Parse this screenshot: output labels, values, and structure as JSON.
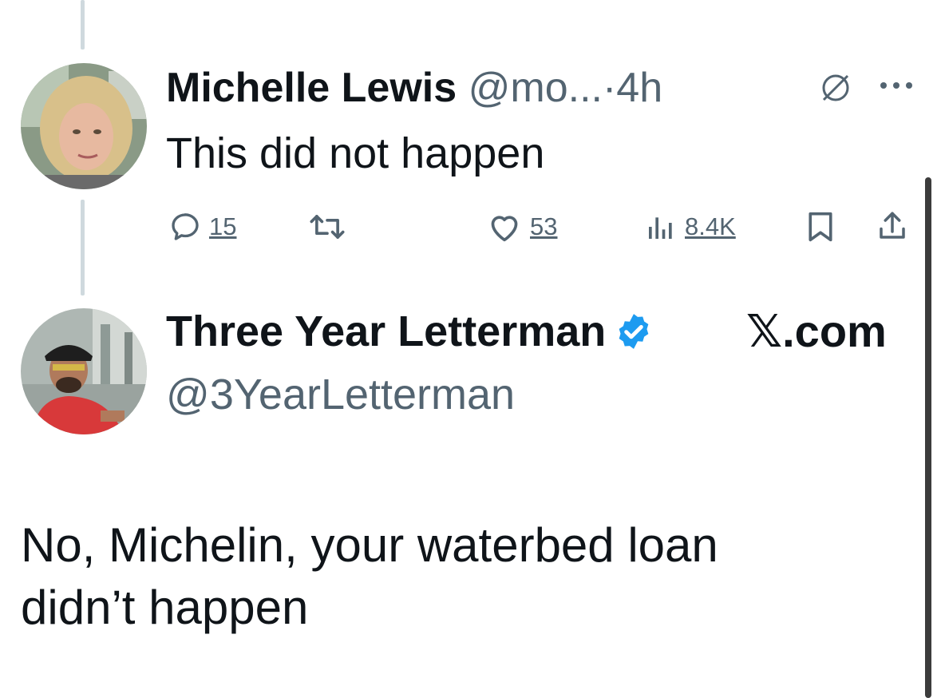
{
  "reply_tweet": {
    "author_name": "Michelle Lewis",
    "author_handle": "@mo...",
    "separator": "·",
    "time": "4h",
    "text": "This did not happen",
    "actions": {
      "replies": "15",
      "likes": "53",
      "views": "8.4K"
    }
  },
  "quoted_post": {
    "author_name": "Three Year Letterman",
    "verified": true,
    "source": "𝕏.com",
    "author_handle": "@3YearLetterman",
    "text_line1": "No, Michelin, your waterbed loan",
    "text_line2": "didn’t happen"
  },
  "colors": {
    "text": "#0f1419",
    "muted": "#536471",
    "verified": "#1d9bf0",
    "thread_line": "#cfd9de"
  },
  "icons": [
    "reply-icon",
    "retweet-icon",
    "like-icon",
    "views-icon",
    "bookmark-icon",
    "share-icon",
    "grok-icon",
    "more-icon",
    "verified-badge-icon"
  ]
}
